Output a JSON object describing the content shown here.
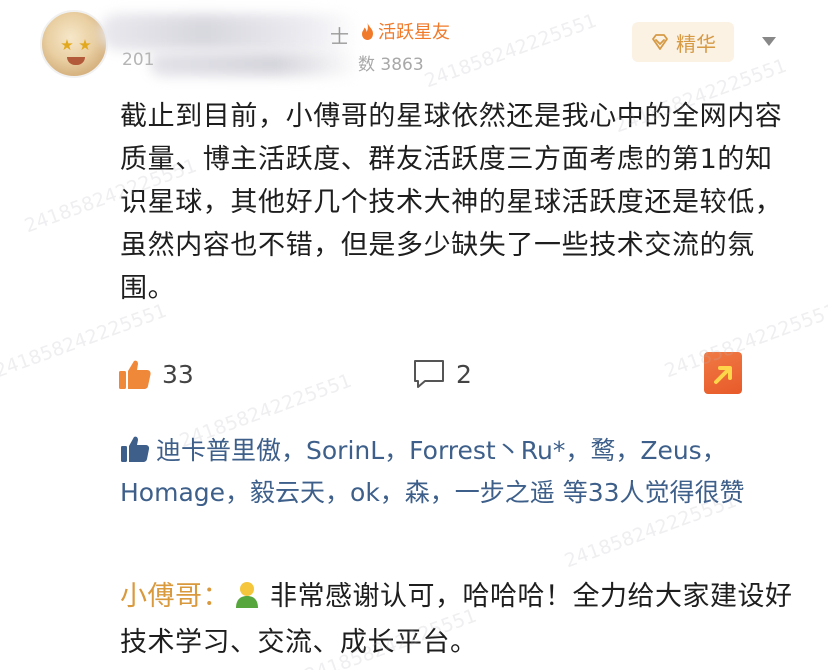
{
  "post": {
    "author": {
      "year_fragment": "201",
      "name_fragment": "士",
      "badge_label": "活跃星友",
      "stats_label": "数 3863"
    },
    "featured_label": "精华",
    "body": "截止到目前，小傅哥的星球依然还是我心中的全网内容质量、博主活跃度、群友活跃度三方面考虑的第1的知识星球，其他好几个技术大神的星球活跃度还是较低，虽然内容也不错，但是多少缺失了一些技术交流的氛围。",
    "like_count": "33",
    "comment_count": "2",
    "likers_text": "迪卡普里傲，SorinL，Forrest丶Ru*，鹜，Zeus，Homage，毅云天，ok，森，一步之遥 等33人觉得很赞",
    "reply": {
      "author": "小傅哥：",
      "text": "非常感谢认可，哈哈哈！全力给大家建设好技术学习、交流、成长平台。"
    },
    "watermark": "241858242225551"
  },
  "colors": {
    "accent_orange": "#f07a2a",
    "featured_gold": "#d69a45",
    "link_blue": "#3d5f8a",
    "reply_author": "#d9993d"
  },
  "icons": {
    "badge": "flame-icon",
    "featured": "diamond-icon",
    "menu": "caret-down-icon",
    "like": "thumbs-up-icon",
    "comment": "comment-bubble-icon",
    "share": "share-arrow-icon",
    "likers": "thumbs-up-icon",
    "reply_emoji": "person-emoji-icon"
  }
}
